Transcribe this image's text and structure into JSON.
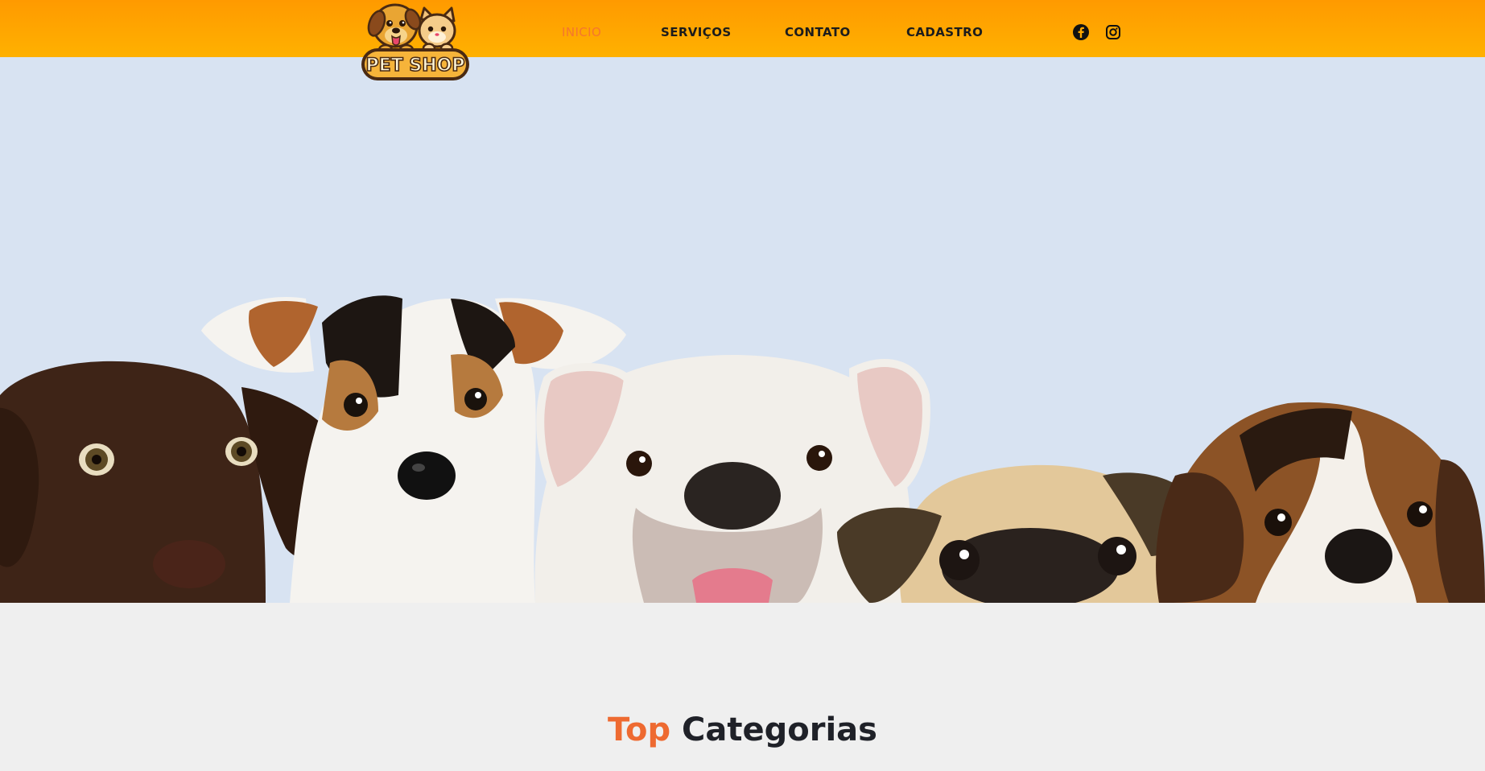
{
  "brand": {
    "logo_text": "PET SHOP",
    "colors": {
      "header_top": "#ff9a00",
      "header_bottom": "#ffb100",
      "accent": "#ee6a31",
      "hero_bg": "#d8e3f2",
      "page_bg": "#efefef"
    }
  },
  "nav": {
    "items": [
      {
        "label": "INICIO",
        "active": true
      },
      {
        "label": "SERVIÇOS",
        "active": false
      },
      {
        "label": "CONTATO",
        "active": false
      },
      {
        "label": "CADASTRO",
        "active": false
      }
    ]
  },
  "social": {
    "icons": [
      "facebook-icon",
      "instagram-icon"
    ]
  },
  "hero": {
    "image": "five-puppies-photo"
  },
  "section": {
    "title_accent": "Top",
    "title_rest": "Categorias"
  }
}
